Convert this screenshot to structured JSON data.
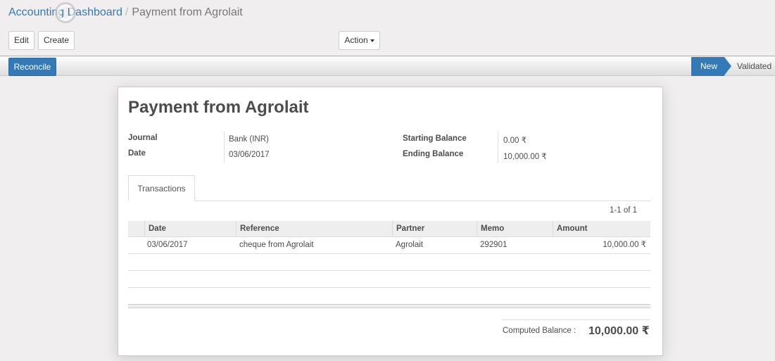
{
  "breadcrumb": {
    "parent": "Accounting Dashboard",
    "separator": "/",
    "current": "Payment from Agrolait"
  },
  "toolbar": {
    "edit_label": "Edit",
    "create_label": "Create",
    "action_label": "Action"
  },
  "statusbar": {
    "reconcile_label": "Reconcile",
    "stages": [
      "New",
      "Validated"
    ],
    "active_stage": "New"
  },
  "form": {
    "title": "Payment from Agrolait",
    "journal_label": "Journal",
    "journal_value": "Bank (INR)",
    "date_label": "Date",
    "date_value": "03/06/2017",
    "starting_balance_label": "Starting Balance",
    "starting_balance_value": "0.00 ₹",
    "ending_balance_label": "Ending Balance",
    "ending_balance_value": "10,000.00 ₹"
  },
  "tabs": [
    "Transactions"
  ],
  "transactions": {
    "pager": "1-1 of 1",
    "columns": [
      "Date",
      "Reference",
      "Partner",
      "Memo",
      "Amount"
    ],
    "rows": [
      {
        "date": "03/06/2017",
        "reference": "cheque from Agrolait",
        "partner": "Agrolait",
        "memo": "292901",
        "amount": "10,000.00 ₹"
      }
    ]
  },
  "summary": {
    "computed_balance_label": "Computed Balance :",
    "computed_balance_value": "10,000.00 ₹"
  },
  "colors": {
    "primary": "#337ab7",
    "background": "#f0eeee",
    "text": "#4c4c4c"
  }
}
